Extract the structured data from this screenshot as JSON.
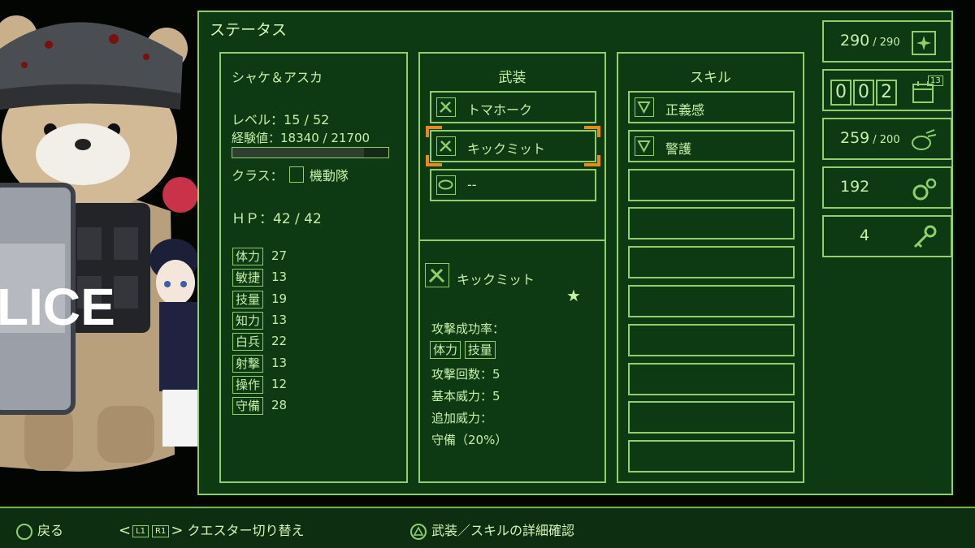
{
  "screen_title": "ステータス",
  "character": {
    "name": "シャケ＆アスカ",
    "level_label": "レベル：",
    "level": "15 / 52",
    "exp_label": "経験値：",
    "exp": "18340 / 21700",
    "exp_progress": 0.845,
    "class_label": "クラス：",
    "class_name": "機動隊",
    "hp_label": "ＨＰ：",
    "hp": "42 / 42",
    "stats": [
      {
        "name": "体力",
        "value": "27"
      },
      {
        "name": "敏捷",
        "value": "13"
      },
      {
        "name": "技量",
        "value": "19"
      },
      {
        "name": "知力",
        "value": "13"
      },
      {
        "name": "白兵",
        "value": "22"
      },
      {
        "name": "射撃",
        "value": "13"
      },
      {
        "name": "操作",
        "value": "12"
      },
      {
        "name": "守備",
        "value": "28"
      }
    ]
  },
  "weapons": {
    "header": "武装",
    "items": [
      {
        "label": "トマホーク",
        "icon": "weapon-icon"
      },
      {
        "label": "キックミット",
        "icon": "weapon-icon"
      },
      {
        "label": "--",
        "icon": "accessory-icon"
      }
    ],
    "selected_index": 1
  },
  "detail": {
    "name": "キックミット",
    "rank": "★",
    "hit_rate_label": "攻撃成功率：",
    "hit_tags": [
      "体力",
      "技量"
    ],
    "attack_count": "攻撃回数：5",
    "base_power": "基本威力：5",
    "bonus_label": "追加威力：",
    "bonus_value": "守備（20%）"
  },
  "skills": {
    "header": "スキル",
    "items": [
      "正義感",
      "警護"
    ],
    "empty_slots": 8
  },
  "resources": [
    {
      "value": "290",
      "max": "/ 290",
      "icon": "sparkle-card-icon"
    },
    {
      "digits": [
        "0",
        "0",
        "2"
      ],
      "badge": "13",
      "icon": "calendar-icon"
    },
    {
      "value": "259",
      "max": "/ 200",
      "icon": "food-icon"
    },
    {
      "value": "192",
      "max": "",
      "icon": "gears-icon"
    },
    {
      "value": "4",
      "max": "",
      "icon": "key-icon"
    }
  ],
  "hints": {
    "back": "戻る",
    "l1": "L1",
    "r1": "R1",
    "switch": "クエスター切り替え",
    "detail": "武装／スキルの詳細確認"
  },
  "art": {
    "shield_text": "LICE"
  },
  "colors": {
    "panel": "#0e3a13",
    "line": "#8fd06a",
    "text": "#c6f0a8",
    "highlight": "#e8891a"
  }
}
